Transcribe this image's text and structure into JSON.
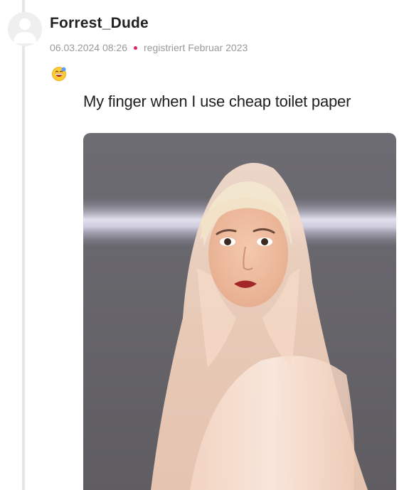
{
  "post": {
    "author": "Forrest_Dude",
    "timestamp": "06.03.2024 08:26",
    "registered": "registriert Februar 2023",
    "separator_color": "#e0245e",
    "emoji_icon": "grinning-face-emoji-icon"
  },
  "meme": {
    "caption": "My finger when I use cheap toilet paper",
    "image": "photo of a woman in a sheer white hooded veil"
  }
}
